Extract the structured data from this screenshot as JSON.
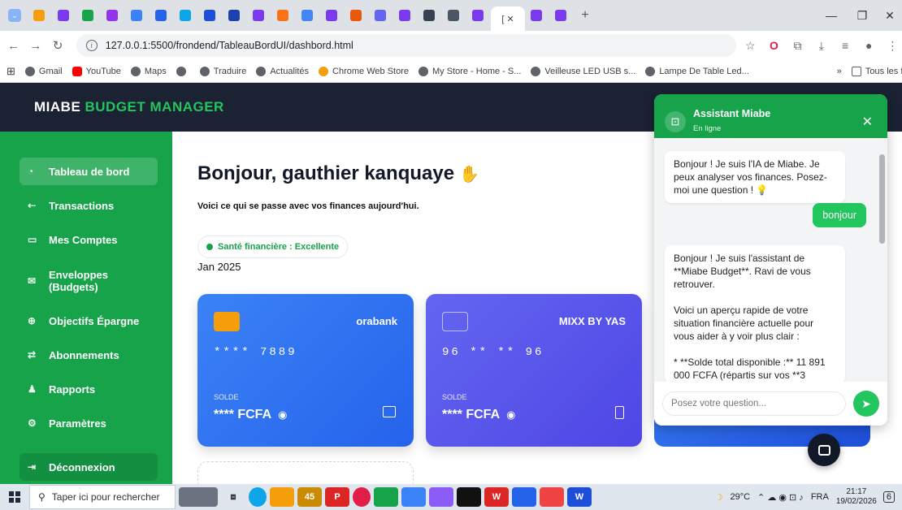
{
  "browser": {
    "url": "127.0.0.1:5500/frondend/TableauBordUI/dashbord.html",
    "bookmarks": [
      "Gmail",
      "YouTube",
      "Maps",
      "Traduire",
      "Actualités",
      "Chrome Web Store",
      "My Store - Home - S...",
      "Veilleuse LED USB s...",
      "Lampe De Table Led..."
    ],
    "all_bookmarks": "Tous les favoris",
    "overflow": "»"
  },
  "app": {
    "title_part1": "MIABE ",
    "title_part2": "BUDGET MAN",
    "title_part3": "AGER"
  },
  "sidebar": {
    "items": [
      {
        "label": "Tableau de bord",
        "icon": "dashboard-icon"
      },
      {
        "label": "Transactions",
        "icon": "transfer-icon"
      },
      {
        "label": "Mes Comptes",
        "icon": "wallet-icon"
      },
      {
        "label": "Enveloppes (Budgets)",
        "icon": "envelope-icon"
      },
      {
        "label": "Objectifs Épargne",
        "icon": "target-icon"
      },
      {
        "label": "Abonnements",
        "icon": "repeat-icon"
      },
      {
        "label": "Rapports",
        "icon": "chart-icon"
      },
      {
        "label": "Paramètres",
        "icon": "gear-icon"
      }
    ],
    "logout": "Déconnexion"
  },
  "main": {
    "greeting": "Bonjour, gauthier kanquaye",
    "subtitle": "Voici ce qui se passe avec vos finances aujourd'hui.",
    "health": "Santé financière : Excellente",
    "month": "Jan 2025"
  },
  "cards": [
    {
      "bank": "orabank",
      "number": "**** 7889",
      "solde_label": "SOLDE",
      "solde": "**** FCFA",
      "color_from": "#3b82f6",
      "color_to": "#2563eb"
    },
    {
      "bank": "MIXX BY YAS",
      "number": "96 ** ** 96",
      "solde_label": "SOLDE",
      "solde": "**** FCFA",
      "color_from": "#6366f1",
      "color_to": "#4f46e5"
    }
  ],
  "chat": {
    "name": "Assistant Miabe",
    "status": "En ligne",
    "messages": [
      {
        "from": "bot",
        "text": "Bonjour ! Je suis l'IA de Miabe. Je peux analyser vos finances. Posez-moi une question ! 💡"
      },
      {
        "from": "user",
        "text": "bonjour"
      },
      {
        "from": "bot",
        "text": "Bonjour ! Je suis l'assistant de **Miabe Budget**. Ravi de vous retrouver."
      },
      {
        "from": "bot",
        "text": "Voici un aperçu rapide de votre situation financière actuelle pour vous aider à y voir plus clair :"
      },
      {
        "from": "bot",
        "text": "*  **Solde total disponible :** 11 891 000 FCFA (répartis sur vos **3"
      }
    ],
    "placeholder": "Posez votre question..."
  },
  "taskbar": {
    "search": "Taper ici pour rechercher",
    "weather": "29°C",
    "lang": "FRA",
    "time": "21:17",
    "date": "19/02/2026",
    "badge": "45",
    "notif": "6"
  }
}
